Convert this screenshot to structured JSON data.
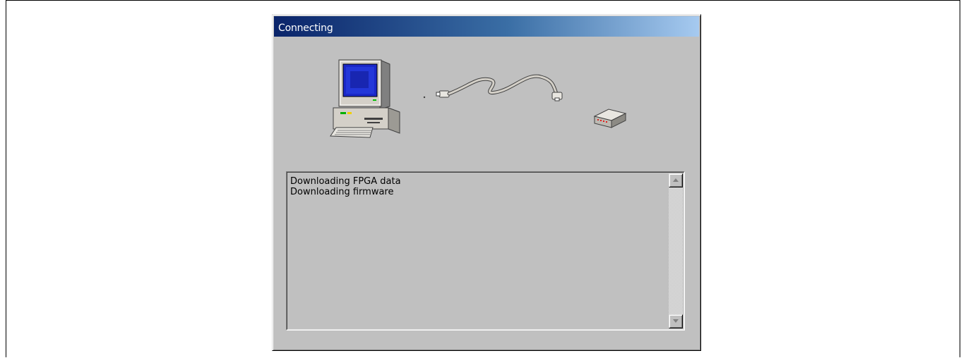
{
  "window": {
    "title": "Connecting"
  },
  "illustration": {
    "icons": [
      "computer-icon",
      "cable-icon",
      "device-icon"
    ]
  },
  "log": {
    "lines": [
      "Downloading FPGA data",
      "Downloading firmware"
    ]
  },
  "scrollbar": {
    "up_icon": "arrow-up-icon",
    "down_icon": "arrow-down-icon"
  },
  "colors": {
    "face": "#c0c0c0",
    "titlebar_start": "#0a246a",
    "titlebar_end": "#a6caf0",
    "monitor_screen": "#1a28c8"
  }
}
